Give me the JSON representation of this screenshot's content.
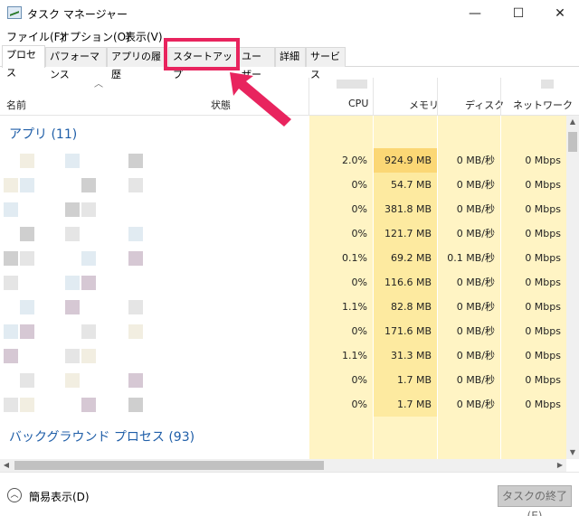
{
  "window": {
    "title": "タスク マネージャー",
    "minimize": "—",
    "maximize": "☐",
    "close": "✕"
  },
  "menu": [
    "ファイル(F)",
    "オプション(O)",
    "表示(V)"
  ],
  "tabs": [
    "プロセス",
    "パフォーマンス",
    "アプリの履歴",
    "スタートアップ",
    "ユーザー",
    "詳細",
    "サービス"
  ],
  "active_tab": "プロセス",
  "highlighted_tab": "スタートアップ",
  "columns": {
    "name": "名前",
    "status": "状態",
    "cpu": "CPU",
    "memory": "メモリ",
    "disk": "ディスク",
    "network": "ネットワーク"
  },
  "groups": {
    "apps": "アプリ (11)",
    "background": "バックグラウンド プロセス (93)"
  },
  "rows": [
    {
      "cpu": "2.0%",
      "memory": "924.9 MB",
      "disk": "0 MB/秒",
      "network": "0 Mbps"
    },
    {
      "cpu": "0%",
      "memory": "54.7 MB",
      "disk": "0 MB/秒",
      "network": "0 Mbps"
    },
    {
      "cpu": "0%",
      "memory": "381.8 MB",
      "disk": "0 MB/秒",
      "network": "0 Mbps"
    },
    {
      "cpu": "0%",
      "memory": "121.7 MB",
      "disk": "0 MB/秒",
      "network": "0 Mbps"
    },
    {
      "cpu": "0.1%",
      "memory": "69.2 MB",
      "disk": "0.1 MB/秒",
      "network": "0 Mbps"
    },
    {
      "cpu": "0%",
      "memory": "116.6 MB",
      "disk": "0 MB/秒",
      "network": "0 Mbps"
    },
    {
      "cpu": "1.1%",
      "memory": "82.8 MB",
      "disk": "0 MB/秒",
      "network": "0 Mbps"
    },
    {
      "cpu": "0%",
      "memory": "171.6 MB",
      "disk": "0 MB/秒",
      "network": "0 Mbps"
    },
    {
      "cpu": "1.1%",
      "memory": "31.3 MB",
      "disk": "0 MB/秒",
      "network": "0 Mbps"
    },
    {
      "cpu": "0%",
      "memory": "1.7 MB",
      "disk": "0 MB/秒",
      "network": "0 Mbps"
    },
    {
      "cpu": "0%",
      "memory": "1.7 MB",
      "disk": "0 MB/秒",
      "network": "0 Mbps"
    }
  ],
  "footer": {
    "fewer_details": "簡易表示(D)",
    "end_task": "タスクの終了(E)"
  },
  "colors": {
    "accent": "#e8245e",
    "group_text": "#1f5ea8",
    "heat_light": "#fff4c4",
    "heat_med": "#fdeaa0",
    "heat_strong": "#fbd775"
  },
  "icons": {
    "app": "task-manager-icon",
    "sort": "sort-up-icon",
    "fewer": "chevron-up-circle-icon"
  }
}
